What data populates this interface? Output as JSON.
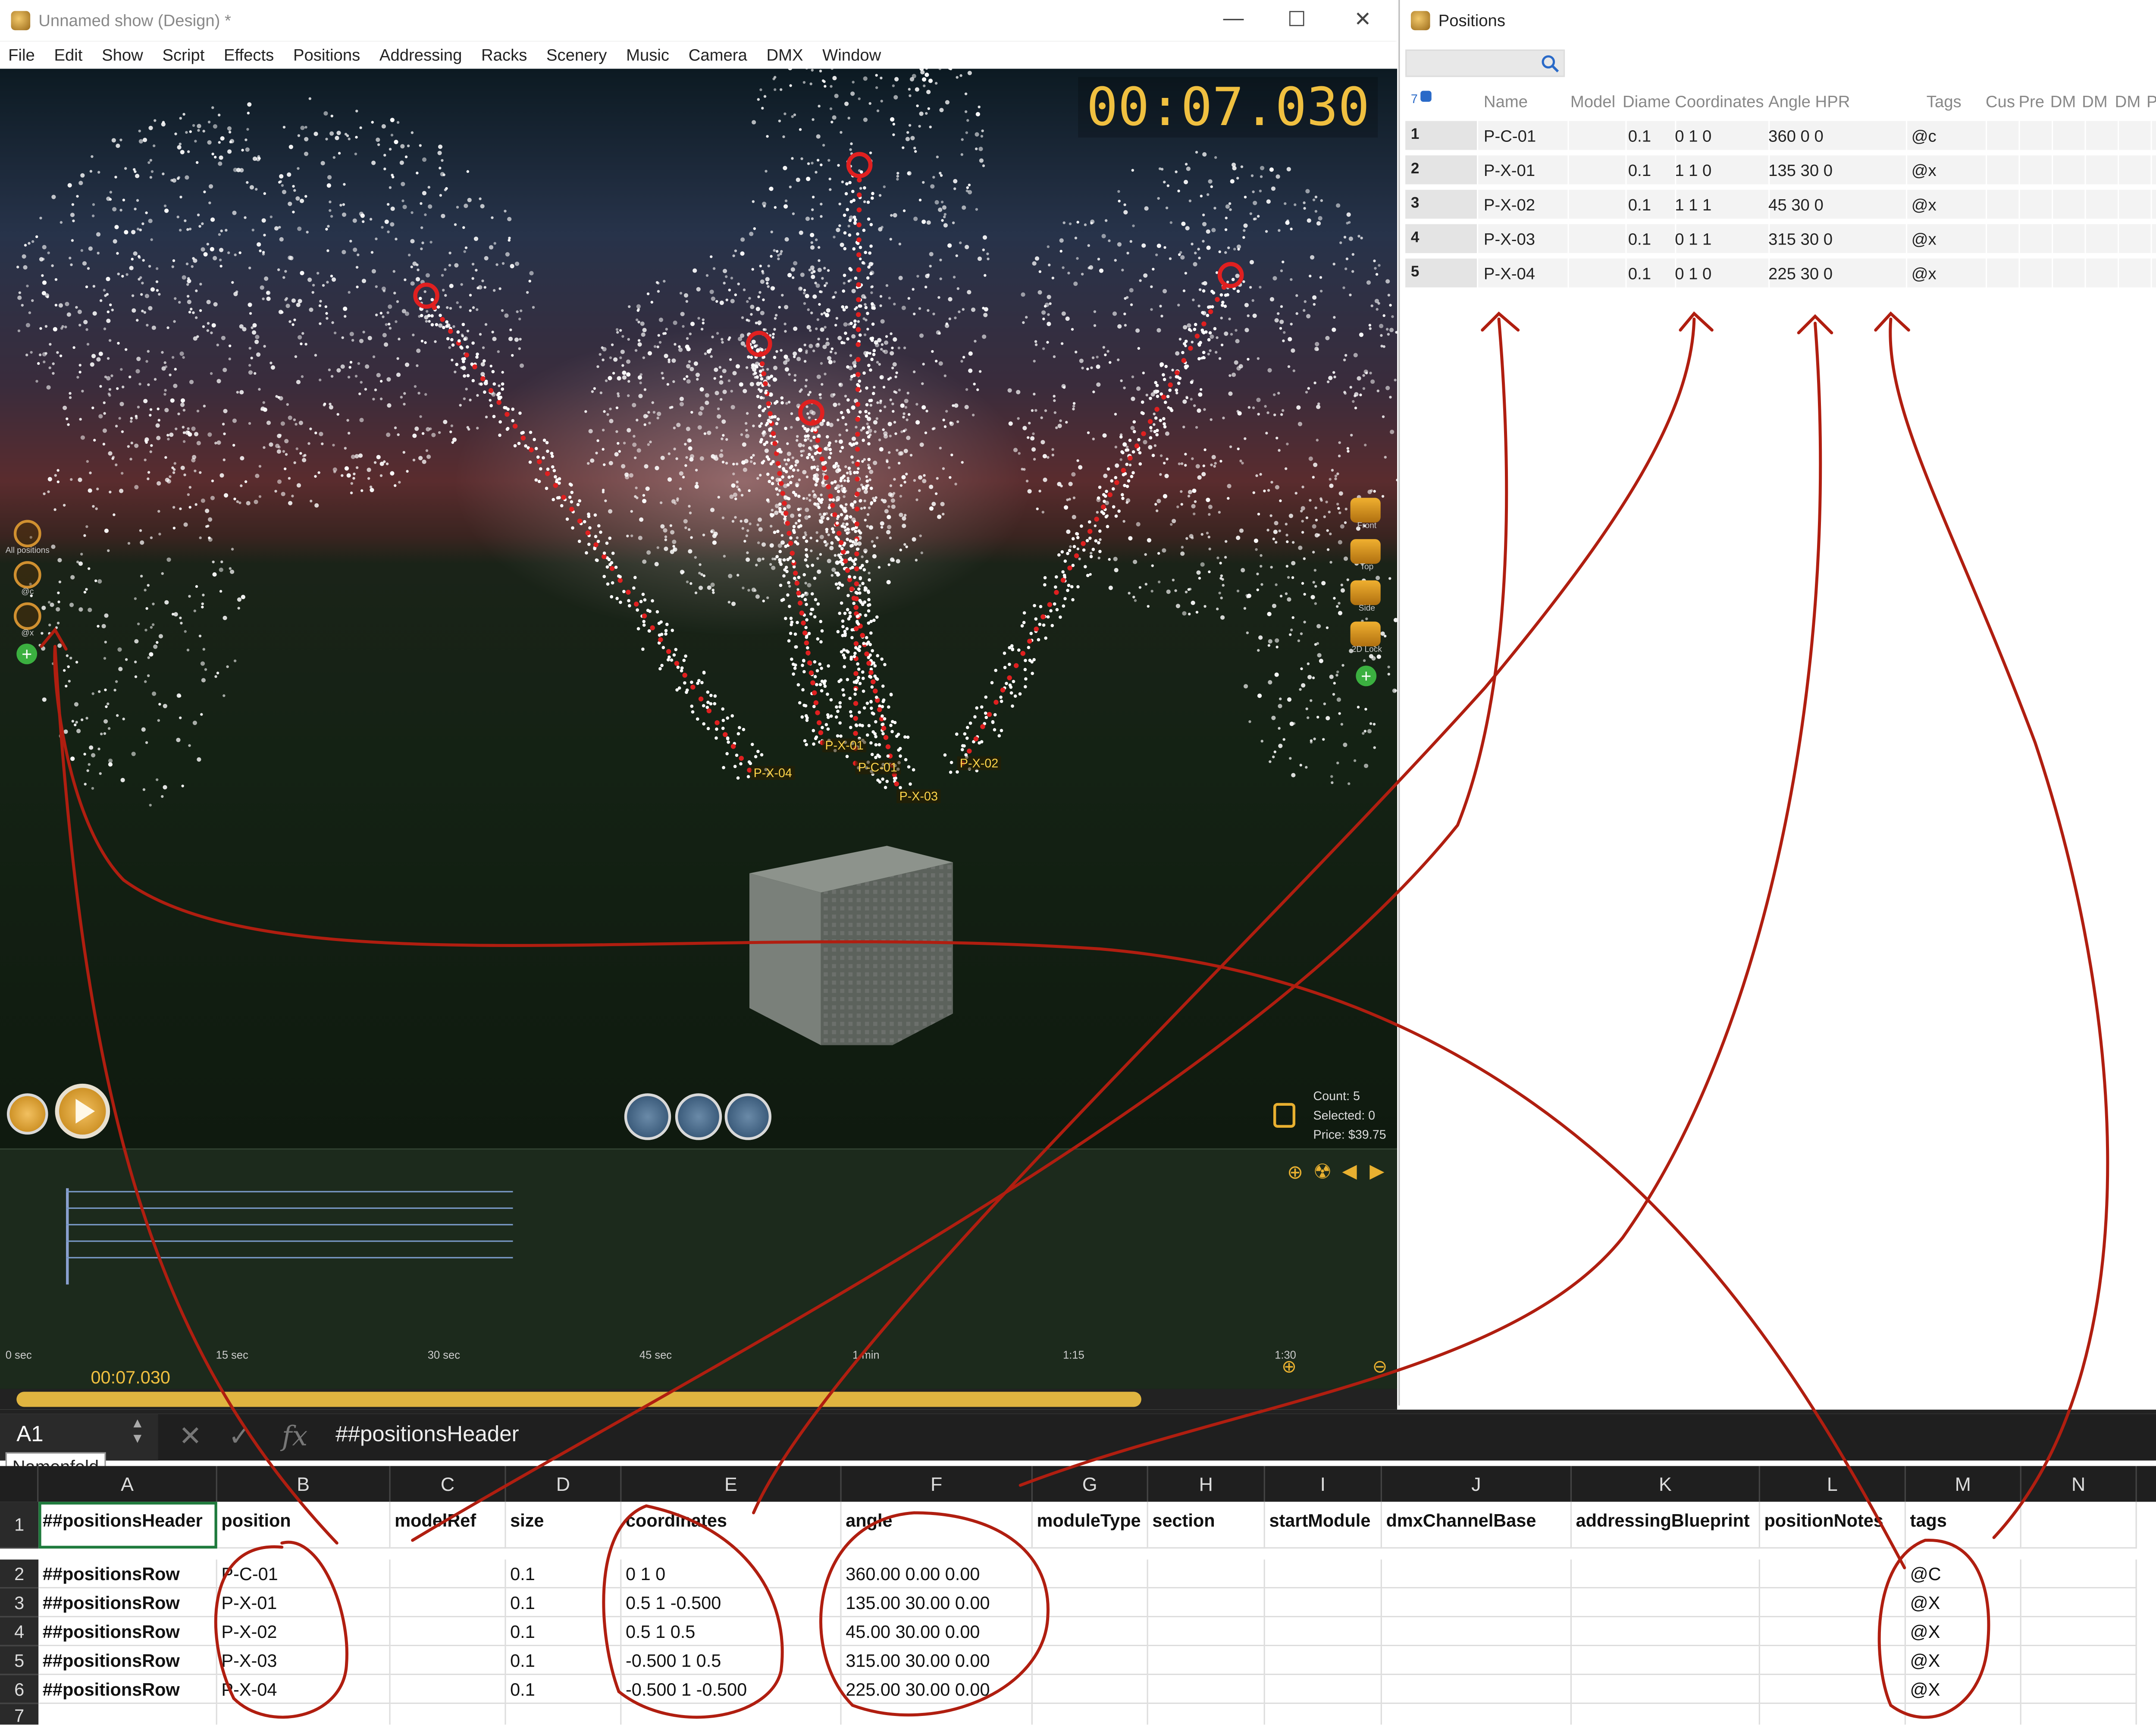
{
  "main_window": {
    "title": "Unnamed show (Design) *",
    "controls": {
      "minimize": "—",
      "maximize": "☐",
      "close": "✕"
    },
    "menu": [
      "File",
      "Edit",
      "Show",
      "Script",
      "Effects",
      "Positions",
      "Addressing",
      "Racks",
      "Scenery",
      "Music",
      "Camera",
      "DMX",
      "Window"
    ]
  },
  "viewport": {
    "timer": "00:07.030",
    "position_labels": [
      "P-X-04",
      "P-X-01",
      "P-C-01",
      "P-X-03",
      "P-X-02"
    ],
    "left_sidebar": [
      {
        "label": "All positions",
        "icon": "all-positions-icon"
      },
      {
        "label": "@c",
        "icon": "position-group-icon"
      },
      {
        "label": "@x",
        "icon": "position-group-icon"
      }
    ],
    "right_sidebar": [
      {
        "label": "Front",
        "icon": "camera-icon"
      },
      {
        "label": "Top",
        "icon": "camera-icon"
      },
      {
        "label": "Side",
        "icon": "camera-icon"
      },
      {
        "label": "2D Lock",
        "icon": "camera-lock-icon"
      }
    ],
    "stats": {
      "count": "Count: 5",
      "selected": "Selected: 0",
      "price": "Price: $39.75"
    },
    "colors": {
      "timer": "#f0c040",
      "trail": "#e02020",
      "spark": "#ffffff"
    }
  },
  "timeline": {
    "ticks": [
      "0 sec",
      "15 sec",
      "30 sec",
      "45 sec",
      "1 min",
      "1:15",
      "1:30"
    ],
    "playhead": "00:07.030"
  },
  "positions_window": {
    "title": "Positions",
    "row_count_badge": "7",
    "columns": [
      "Name",
      "Model",
      "Diame",
      "Coordinates",
      "Angle HPR",
      "Tags",
      "Cus",
      "Pre",
      "DM",
      "DM",
      "DM",
      "P"
    ],
    "rows": [
      {
        "num": "1",
        "name": "P-C-01",
        "diameter": "0.1",
        "coordinates": "0 1 0",
        "angle": "360 0 0",
        "tags": "@c"
      },
      {
        "num": "2",
        "name": "P-X-01",
        "diameter": "0.1",
        "coordinates": "1 1 0",
        "angle": "135 30 0",
        "tags": "@x"
      },
      {
        "num": "3",
        "name": "P-X-02",
        "diameter": "0.1",
        "coordinates": "1 1 1",
        "angle": "45 30 0",
        "tags": "@x"
      },
      {
        "num": "4",
        "name": "P-X-03",
        "diameter": "0.1",
        "coordinates": "0 1 1",
        "angle": "315 30 0",
        "tags": "@x"
      },
      {
        "num": "5",
        "name": "P-X-04",
        "diameter": "0.1",
        "coordinates": "0 1 0",
        "angle": "225 30 0",
        "tags": "@x"
      }
    ]
  },
  "spreadsheet": {
    "name_box": "A1",
    "name_box_tooltip": "Namenfeld",
    "formula": "##positionsHeader",
    "column_letters": [
      "A",
      "B",
      "C",
      "D",
      "E",
      "F",
      "G",
      "H",
      "I",
      "J",
      "K",
      "L",
      "M",
      "N"
    ],
    "row_numbers": [
      "1",
      "2",
      "3",
      "4",
      "5",
      "6",
      "7"
    ],
    "header_row": [
      "##positionsHeader",
      "position",
      "modelRef",
      "size",
      "coordinates",
      "angle",
      "moduleType",
      "section",
      "startModule",
      "dmxChannelBase",
      "addressingBlueprint",
      "positionNotes",
      "tags",
      ""
    ],
    "data_rows": [
      [
        "##positionsRow",
        "P-C-01",
        "",
        "0.1",
        "0 1 0",
        "360.00 0.00 0.00",
        "",
        "",
        "",
        "",
        "",
        "",
        "@C"
      ],
      [
        "##positionsRow",
        "P-X-01",
        "",
        "0.1",
        "0.5 1 -0.500",
        "135.00 30.00 0.00",
        "",
        "",
        "",
        "",
        "",
        "",
        "@X"
      ],
      [
        "##positionsRow",
        "P-X-02",
        "",
        "0.1",
        "0.5 1 0.5",
        "45.00 30.00 0.00",
        "",
        "",
        "",
        "",
        "",
        "",
        "@X"
      ],
      [
        "##positionsRow",
        "P-X-03",
        "",
        "0.1",
        "-0.500 1 0.5",
        "315.00 30.00 0.00",
        "",
        "",
        "",
        "",
        "",
        "",
        "@X"
      ],
      [
        "##positionsRow",
        "P-X-04",
        "",
        "0.1",
        "-0.500 1 -0.500",
        "225.00 30.00 0.00",
        "",
        "",
        "",
        "",
        "",
        "",
        "@X"
      ]
    ]
  },
  "annotation_color": "#b01e10"
}
